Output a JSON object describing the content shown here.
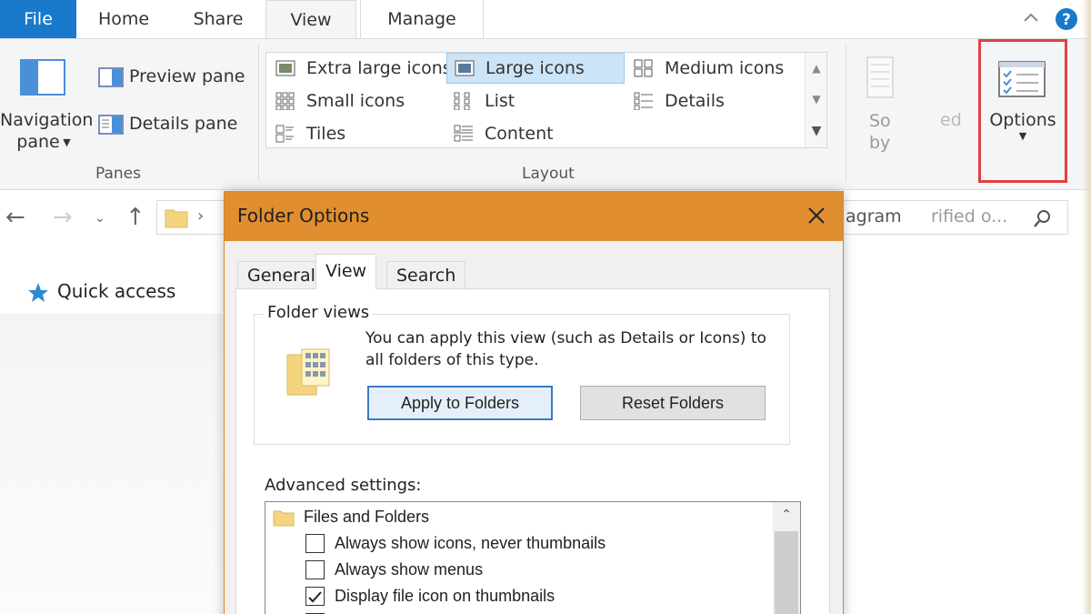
{
  "ribbon_tabs": {
    "file": "File",
    "home": "Home",
    "share": "Share",
    "view": "View",
    "manage": "Manage"
  },
  "panes_group": {
    "navigation_pane_line1": "Navigation",
    "navigation_pane_line2": "pane",
    "preview_pane": "Preview pane",
    "details_pane": "Details pane",
    "label": "Panes"
  },
  "layout_group": {
    "items": [
      "Extra large icons",
      "Large icons",
      "Medium icons",
      "Small icons",
      "List",
      "Details",
      "Tiles",
      "Content"
    ],
    "selected": "Large icons",
    "label": "Layout"
  },
  "current_view_group": {
    "sort_by_line1": "So",
    "sort_by_line2": "by",
    "partial_text": "ed"
  },
  "options_button": {
    "label": "Options",
    "highlight_color": "#e04040"
  },
  "address_bar": {
    "search_fragment": "agram",
    "search_fragment2": "rified o..."
  },
  "nav_pane": {
    "quick_access": "Quick access"
  },
  "dialog": {
    "title": "Folder Options",
    "tabs": [
      "General",
      "View",
      "Search"
    ],
    "active_tab": "View",
    "folder_views": {
      "legend": "Folder views",
      "description": "You can apply this view (such as Details or Icons) to all folders of this type.",
      "apply_button": "Apply to Folders",
      "reset_button": "Reset Folders"
    },
    "advanced": {
      "label": "Advanced settings:",
      "root": "Files and Folders",
      "items": [
        {
          "label": "Always show icons, never thumbnails",
          "checked": false
        },
        {
          "label": "Always show menus",
          "checked": false
        },
        {
          "label": "Display file icon on thumbnails",
          "checked": true
        }
      ]
    }
  },
  "colors": {
    "file_tab": "#1979ca",
    "dialog_title": "#e08e2f",
    "ribbon_bg": "#f4f5f7",
    "selection": "#cce4f7"
  },
  "icons": {
    "help": "help-icon",
    "collapse": "chevron-up-icon",
    "close": "close-icon",
    "search": "search-icon",
    "quick_access": "star-icon",
    "folder": "folder-icon"
  }
}
